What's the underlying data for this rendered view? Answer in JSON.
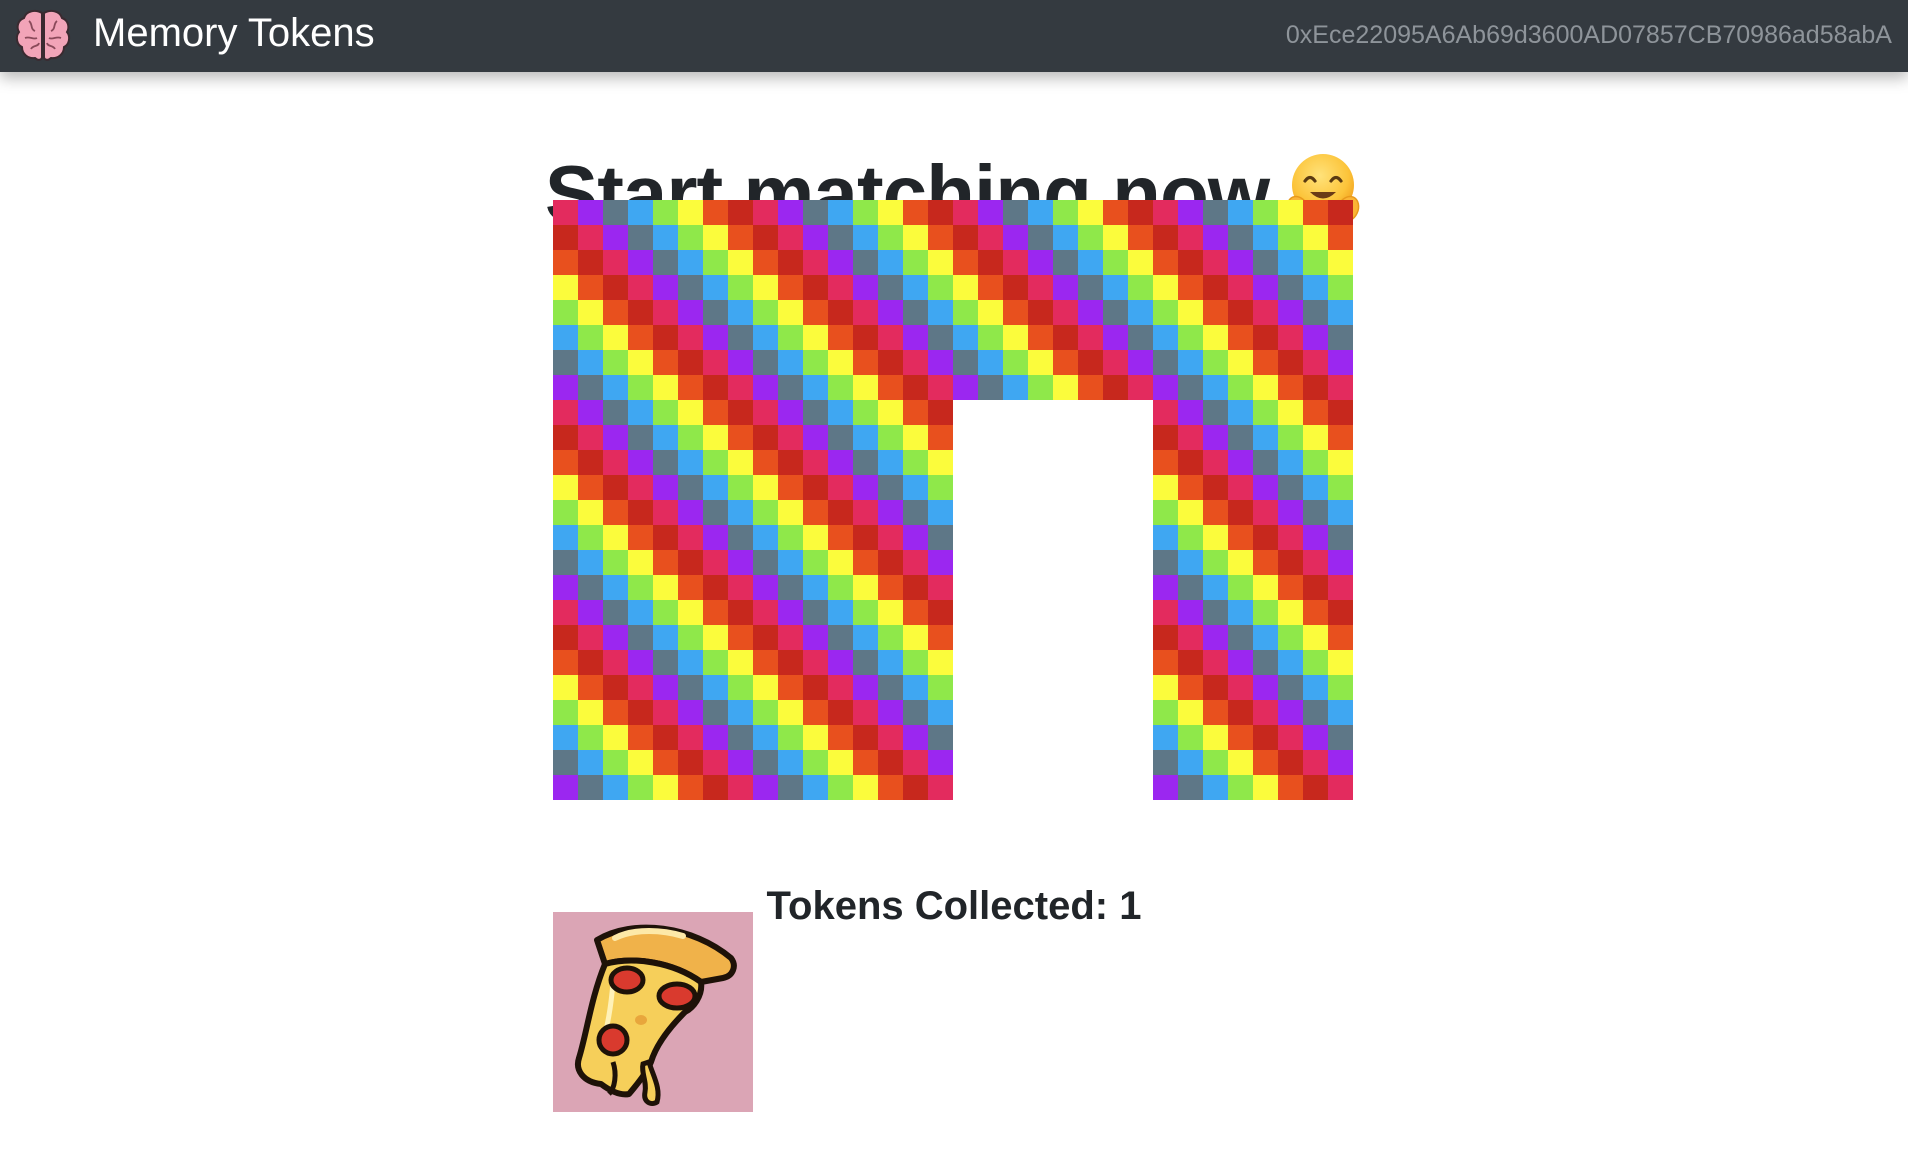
{
  "app": {
    "name": "Memory Tokens",
    "logo_icon": "brain-icon",
    "logo_color": "#f2a4b8"
  },
  "account": {
    "address": "0xEce22095A6Ab69d3600AD07857CB70986ad58abA"
  },
  "main": {
    "title": "Start matching now",
    "title_emoji": "hugging-face-emoji"
  },
  "board": {
    "columns": 4,
    "rows": 3,
    "card_back_icon": "rainbow-checker-pattern",
    "cards": [
      {
        "state": "hidden"
      },
      {
        "state": "hidden"
      },
      {
        "state": "hidden"
      },
      {
        "state": "hidden"
      },
      {
        "state": "hidden"
      },
      {
        "state": "hidden"
      },
      {
        "state": "matched"
      },
      {
        "state": "hidden"
      },
      {
        "state": "hidden"
      },
      {
        "state": "hidden"
      },
      {
        "state": "matched"
      },
      {
        "state": "hidden"
      }
    ],
    "palette": [
      "#e32b5e",
      "#9b27f0",
      "#5e7787",
      "#3fa7f2",
      "#8fe84a",
      "#fbfc3c",
      "#e8501e",
      "#c7281d"
    ]
  },
  "collected": {
    "heading": "Tokens Collected: 1",
    "count": 1,
    "tokens": [
      {
        "name": "pizza",
        "icon": "pizza-icon",
        "background": "#dba5b5"
      }
    ]
  }
}
